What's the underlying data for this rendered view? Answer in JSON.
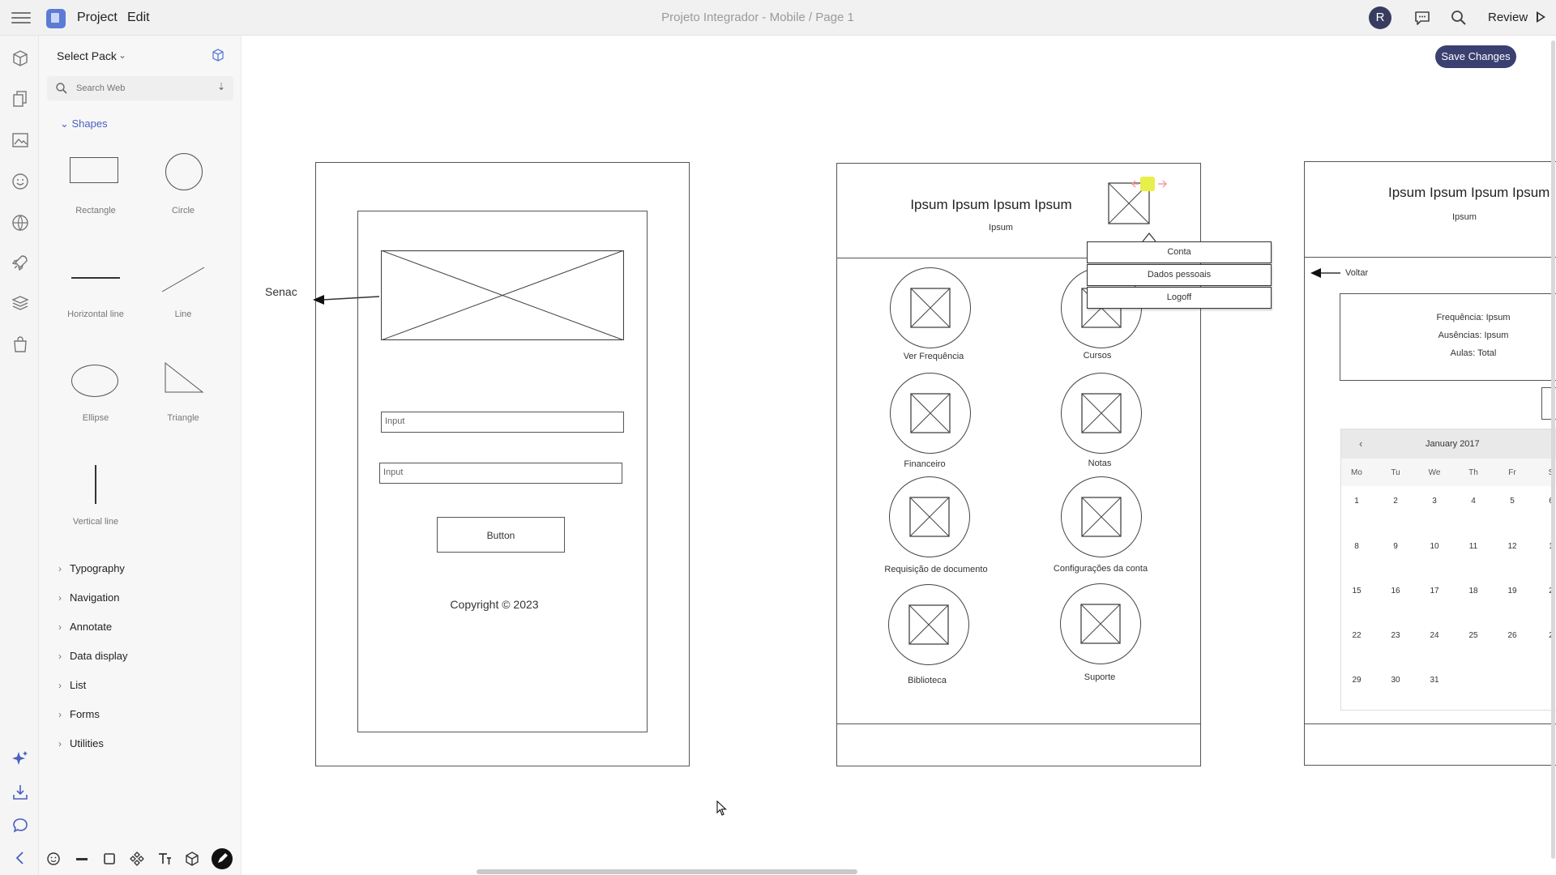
{
  "topbar": {
    "menu_project": "Project",
    "menu_edit": "Edit",
    "doc_title": "Projeto Integrador - Mobile / Page 1",
    "avatar_letter": "R",
    "review_label": "Review"
  },
  "panel": {
    "select_pack": "Select Pack",
    "search_placeholder": "Search Web",
    "shapes_section": "Shapes",
    "shapes": [
      {
        "label": "Rectangle",
        "icon": "rectangle-shape"
      },
      {
        "label": "Circle",
        "icon": "circle-shape"
      },
      {
        "label": "Horizontal line",
        "icon": "horizontal-line-shape"
      },
      {
        "label": "Line",
        "icon": "diagonal-line-shape"
      },
      {
        "label": "Ellipse",
        "icon": "ellipse-shape"
      },
      {
        "label": "Triangle",
        "icon": "triangle-shape"
      },
      {
        "label": "Vertical line",
        "icon": "vertical-line-shape"
      }
    ],
    "categories": [
      "Typography",
      "Navigation",
      "Annotate",
      "Data display",
      "List",
      "Forms",
      "Utilities"
    ]
  },
  "canvas": {
    "save_button": "Save Changes",
    "frame1": {
      "input1": "Input",
      "input2": "Input",
      "button": "Button",
      "copyright": "Copyright © 2023",
      "senac_label": "Senac"
    },
    "frame2": {
      "headline": "Ipsum Ipsum Ipsum Ipsum",
      "sub": "Ipsum",
      "menu": [
        "Conta",
        "Dados pessoais",
        "Logoff"
      ],
      "items": [
        "Ver Frequência",
        "Cursos",
        "Financeiro",
        "Notas",
        "Requisição de documento",
        "Configurações da conta",
        "Biblioteca",
        "Suporte"
      ]
    },
    "frame3": {
      "headline": "Ipsum Ipsum Ipsum Ipsum",
      "sub": "Ipsum",
      "back": "Voltar",
      "info": [
        "Frequência: Ipsum",
        "Ausências: Ipsum",
        "Aulas: Total"
      ],
      "calendar": {
        "month": "January 2017",
        "weekdays": [
          "Mo",
          "Tu",
          "We",
          "Th",
          "Fr",
          "S"
        ],
        "weeks": [
          [
            "1",
            "2",
            "3",
            "4",
            "5",
            "6"
          ],
          [
            "8",
            "9",
            "10",
            "11",
            "12",
            "1"
          ],
          [
            "15",
            "16",
            "17",
            "18",
            "19",
            "2"
          ],
          [
            "22",
            "23",
            "24",
            "25",
            "26",
            "2"
          ],
          [
            "29",
            "30",
            "31"
          ]
        ]
      }
    }
  },
  "colors": {
    "accent": "#3a4070",
    "logo": "#5b7bd5",
    "shapes_link": "#4a5fc1"
  }
}
